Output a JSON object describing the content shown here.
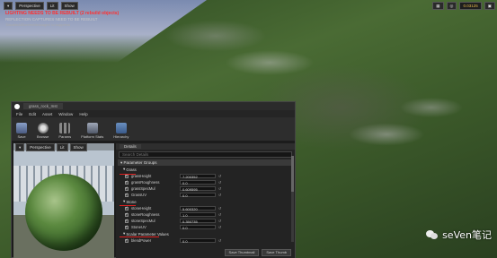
{
  "viewport": {
    "toolbar_left": [
      "Perspective",
      "Lit",
      "Show"
    ],
    "toolbar_right_value": "0.03125",
    "warning_line1": "LIGHTING NEEDS TO BE REBUILT (2 rebuild objects)",
    "warning_line2": "REFLECTION CAPTURES NEED TO BE REBUILT",
    "warning_line3": "'DisableAllScreenMessages' to suppress"
  },
  "editor": {
    "tab_label": "grass_rock_Inst",
    "menu": [
      "File",
      "Edit",
      "Asset",
      "Window",
      "Help"
    ],
    "toolbar": [
      "Save",
      "Browse",
      "Params",
      "Platform Stats",
      "Hierarchy"
    ],
    "preview_bar": [
      "Perspective",
      "Lit",
      "Show"
    ],
    "details_tab": "Details",
    "search_placeholder": "Search Details",
    "section_title": "Parameter Groups",
    "groups": [
      {
        "name": "Grass",
        "params": [
          {
            "name": "grassHeight",
            "value": "7.200352"
          },
          {
            "name": "grassRoughness",
            "value": "0.0"
          },
          {
            "name": "grassSpecMul",
            "value": "0.609595"
          },
          {
            "name": "GrassUV",
            "value": "0.0"
          }
        ]
      },
      {
        "name": "Stone",
        "params": [
          {
            "name": "stoneHeight",
            "value": "5.600320"
          },
          {
            "name": "stoneRoughness",
            "value": "1.0"
          },
          {
            "name": "stoneSpecMul",
            "value": "0.350735"
          },
          {
            "name": "StoneUV",
            "value": "0.0"
          }
        ]
      },
      {
        "name": "Scalar Parameter Values",
        "params": [
          {
            "name": "blendPower",
            "value": "0.0"
          }
        ]
      }
    ],
    "bottom_buttons": [
      "Save Thumbnail",
      "Save Thumb"
    ]
  },
  "watermark": {
    "text": "seVen笔记"
  },
  "colors": {
    "warning": "#ff3030",
    "highlight": "#e02020"
  }
}
